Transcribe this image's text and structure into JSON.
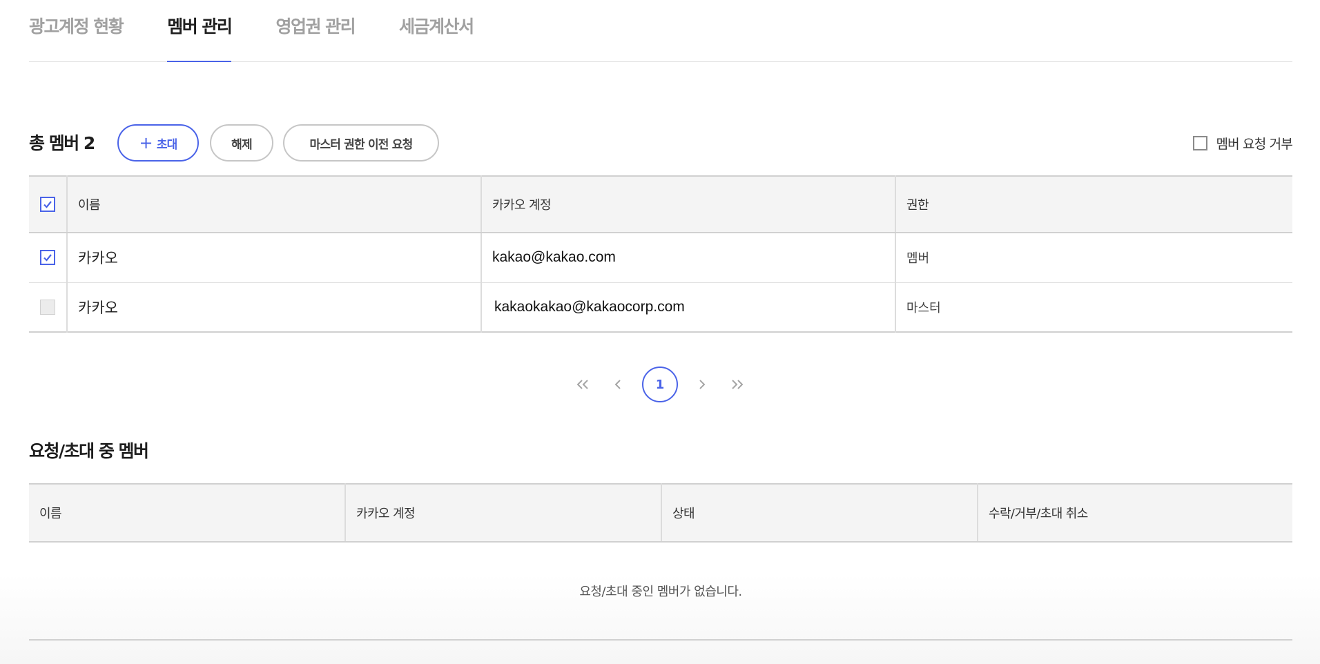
{
  "tabs": [
    {
      "label": "광고계정 현황",
      "active": false
    },
    {
      "label": "멤버 관리",
      "active": true
    },
    {
      "label": "영업권 관리",
      "active": false
    },
    {
      "label": "세금계산서",
      "active": false
    }
  ],
  "members": {
    "title": "총 멤버 2",
    "invite_label": "초대",
    "invite_icon": "plus-icon",
    "release_label": "해제",
    "transfer_label": "마스터 권한 이전 요청",
    "reject_requests_label": "멤버 요청 거부",
    "reject_requests_checked": false,
    "select_all_checked": true,
    "columns": {
      "name": "이름",
      "account": "카카오 계정",
      "role": "권한"
    },
    "rows": [
      {
        "checked": true,
        "name": "카카오",
        "account": "kakao@kakao.com",
        "role": "멤버"
      },
      {
        "checked": false,
        "name": "카카오",
        "account": "kakaokakao@kakaocorp.com",
        "role": "마스터"
      }
    ]
  },
  "pagination": {
    "current_page": "1",
    "icons": [
      "first-page-icon",
      "prev-page-icon",
      "next-page-icon",
      "last-page-icon"
    ]
  },
  "pending": {
    "title": "요청/초대 중 멤버",
    "columns": {
      "name": "이름",
      "account": "카카오 계정",
      "status": "상태",
      "actions": "수락/거부/초대 취소"
    },
    "empty_message": "요청/초대 중인 멤버가 없습니다."
  },
  "colors": {
    "accent": "#4a63e8",
    "inactive_tab": "#a0a0a0",
    "header_bg": "#f4f4f4"
  }
}
